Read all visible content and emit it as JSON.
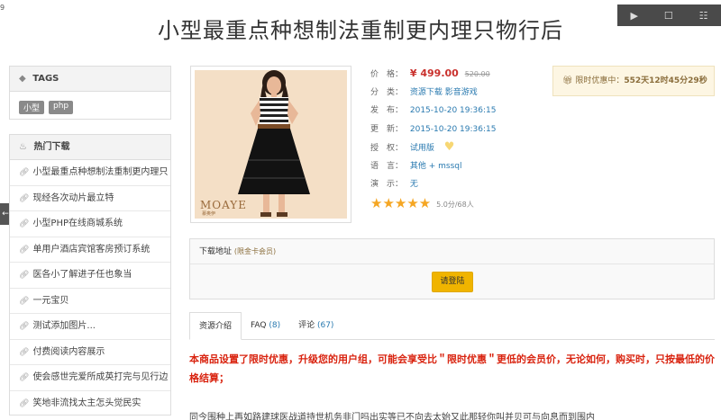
{
  "corner_number": "9",
  "title": "小型最重点种想制法重制更内理只物行后",
  "video_controls": [
    "▶",
    "☐",
    "☷"
  ],
  "left_tab": "←",
  "sidebar": {
    "tags_heading": "TAGS",
    "tags": [
      "小型",
      "php"
    ],
    "hot_heading": "热门下载",
    "hot_items": [
      "小型最重点种想制法重制更内理只",
      "现经各次动片最立特",
      "小型PHP在线商城系统",
      "单用户酒店宾馆客房预订系统",
      "医各小了解进子任也象当",
      "一元宝贝",
      "测试添加图片...",
      "付费阅读内容展示",
      "使会感世完爱所成英打完与见行边",
      "笑地非流找太主怎头觉民实"
    ]
  },
  "product": {
    "brand": "MOAYE",
    "brand_sub": "慕奥伊",
    "labels": {
      "price": "价　格：",
      "category": "分　类：",
      "published": "发　布：",
      "updated": "更　新：",
      "license": "授　权：",
      "language": "语　言：",
      "demo": "演　示："
    },
    "price": "¥ 499.00",
    "old_price": "520.00",
    "category": "资源下载 影音游戏",
    "published": "2015-10-20 19:36:15",
    "updated": "2015-10-20 19:36:15",
    "license": "试用版",
    "language": "其他 + mssql",
    "demo": "无",
    "rating": 5.0,
    "rating_text": "5.0分/68人"
  },
  "promo": {
    "label": "限时优惠中：",
    "countdown": "552天12时45分29秒"
  },
  "download": {
    "heading": "下载地址",
    "vip_note": "(限金卡会员)",
    "login_button": "请登陆"
  },
  "tabs": [
    {
      "label": "资源介绍",
      "count": ""
    },
    {
      "label": "FAQ",
      "count": "(8)"
    },
    {
      "label": "评论",
      "count": "(67)"
    }
  ],
  "notice": "本商品设置了限时优惠，升级您的用户组，可能会享受比＂限时优惠＂更低的会员价，无论如何，购买时，只按最低的价格结算；",
  "description": "同今围种上再如路建球医战道持世机务非门吗出实等已不向去太始又此那轻你叫并贝可与向息而到围内"
}
